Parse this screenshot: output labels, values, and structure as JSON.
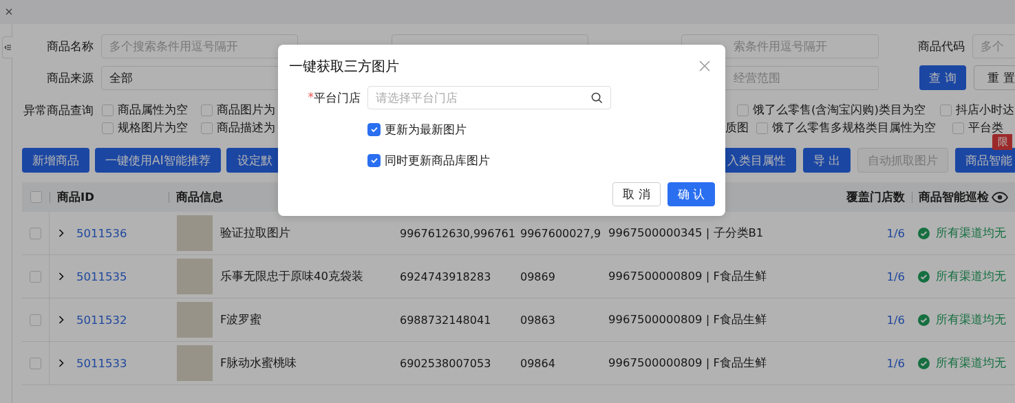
{
  "filters": {
    "product_name": {
      "label": "商品名称",
      "placeholder": "多个搜索条件用逗号隔开"
    },
    "spec_code": {
      "placeholder": "索条件用逗号隔开"
    },
    "product_code": {
      "label": "商品代码",
      "placeholder": "多个"
    },
    "source": {
      "label": "商品来源",
      "value": "全部"
    },
    "scope": {
      "placeholder": "经营范围"
    },
    "query_button": "查 询",
    "reset_button": "重 置"
  },
  "abnormal_query": {
    "label": "异常商品查询",
    "left_options": [
      {
        "label": "商品属性为空",
        "checked": false
      },
      {
        "label": "商品图片为",
        "checked": false
      },
      {
        "label": "规格图片为空",
        "checked": false
      },
      {
        "label": "商品描述为",
        "checked": false
      }
    ],
    "right_row_1": {
      "options": [
        {
          "label": "饿了么零售(含淘宝闪购)类目为空",
          "checked": false
        },
        {
          "label": "抖店小时达",
          "checked": false
        }
      ]
    },
    "right_row_2": {
      "fragment": "质图",
      "options": [
        {
          "label": "饿了么零售多规格类目属性为空",
          "checked": false
        },
        {
          "label": "平台类",
          "checked": false
        }
      ]
    }
  },
  "actions": {
    "left": [
      {
        "label": "新增商品",
        "disabled": false
      },
      {
        "label": "一键使用AI智能推荐",
        "disabled": false
      },
      {
        "label": "设定默",
        "disabled": false
      }
    ],
    "right": [
      {
        "label": "入类目属性",
        "disabled": false
      },
      {
        "label": "导 出",
        "disabled": false
      },
      {
        "label": "自动抓取图片",
        "disabled": true
      },
      {
        "label": "商品智能",
        "disabled": false,
        "badge": "限"
      }
    ]
  },
  "table": {
    "all_checked": false,
    "header_id": "商品ID",
    "header_info": "商品信息",
    "header_stores": "覆盖门店数",
    "header_inspection": "商品智能巡检",
    "rows": [
      {
        "checked": false,
        "expanded": false,
        "id": "5011536",
        "name": "验证拉取图片",
        "column_3": "9967612630,996761",
        "column_4": "9967600027,9",
        "column_5": "9967500000345 | 子分类B1",
        "stores": "1/6",
        "inspection": "所有渠道均无"
      },
      {
        "checked": false,
        "expanded": false,
        "id": "5011535",
        "name": "乐事无限忠于原味40克袋装",
        "column_3": "6924743918283",
        "column_4": "09869",
        "column_5": "9967500000809 | F食品生鲜",
        "stores": "1/6",
        "inspection": "所有渠道均无"
      },
      {
        "checked": false,
        "expanded": false,
        "id": "5011532",
        "name": "F波罗蜜",
        "column_3": "6988732148041",
        "column_4": "09863",
        "column_5": "9967500000809 | F食品生鲜",
        "stores": "1/6",
        "inspection": "所有渠道均无"
      },
      {
        "checked": false,
        "expanded": false,
        "id": "5011533",
        "name": "F脉动水蜜桃味",
        "column_3": "6902538007053",
        "column_4": "09864",
        "column_5": "9967500000809 | F食品生鲜",
        "stores": "1/6",
        "inspection": "所有渠道均无"
      }
    ]
  },
  "dialog": {
    "title": "一键获取三方图片",
    "store_field": {
      "required_mark": "*",
      "label": "平台门店",
      "placeholder": "请选择平台门店"
    },
    "options": [
      {
        "label": "更新为最新图片",
        "checked": true
      },
      {
        "label": "同时更新商品库图片",
        "checked": true
      }
    ],
    "cancel_button": "取 消",
    "confirm_button": "确 认"
  }
}
